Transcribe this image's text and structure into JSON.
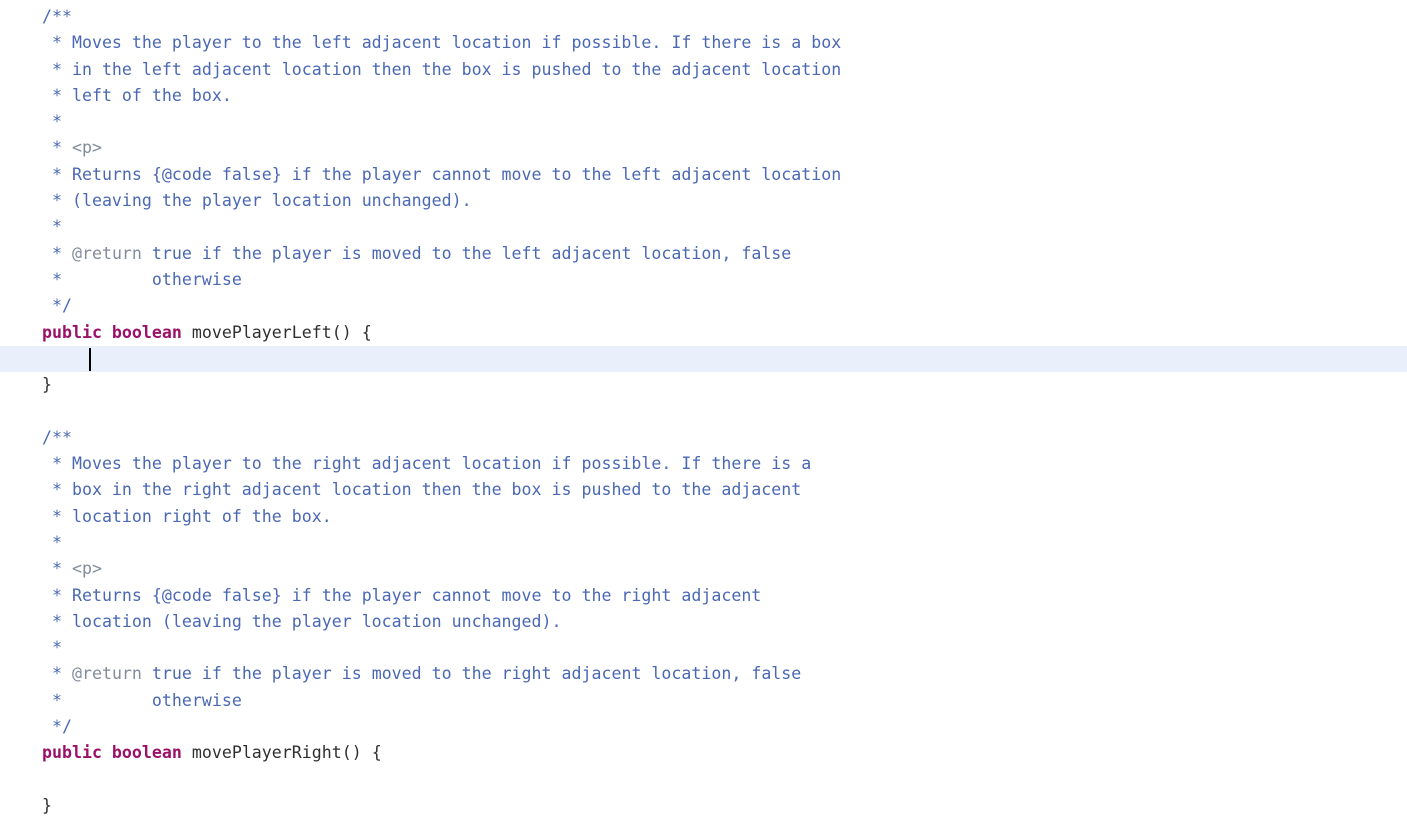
{
  "editor": {
    "language": "java",
    "background_color": "#ffffff",
    "comment_color": "#4a68b3",
    "javadoc_tag_color": "#828c9c",
    "keyword_color": "#9b1069",
    "plain_text_color": "#2f2f2f",
    "current_line_highlight_color": "#e9f0fb",
    "caret_color": "#000000",
    "caret_line_index": 13,
    "caret_column": 4
  },
  "lines": [
    {
      "index": 0,
      "current": false,
      "tokens": [
        {
          "type": "cmt",
          "text": "/**"
        }
      ]
    },
    {
      "index": 1,
      "current": false,
      "tokens": [
        {
          "type": "cmt",
          "text": " * Moves the player to the left adjacent location if possible. If there is a box"
        }
      ]
    },
    {
      "index": 2,
      "current": false,
      "tokens": [
        {
          "type": "cmt",
          "text": " * in the left adjacent location then the box is pushed to the adjacent location"
        }
      ]
    },
    {
      "index": 3,
      "current": false,
      "tokens": [
        {
          "type": "cmt",
          "text": " * left of the box."
        }
      ]
    },
    {
      "index": 4,
      "current": false,
      "tokens": [
        {
          "type": "cmt",
          "text": " *"
        }
      ]
    },
    {
      "index": 5,
      "current": false,
      "tokens": [
        {
          "type": "cmt",
          "text": " * "
        },
        {
          "type": "cmt-tag",
          "text": "<p>"
        }
      ]
    },
    {
      "index": 6,
      "current": false,
      "tokens": [
        {
          "type": "cmt",
          "text": " * Returns {@code false} if the player cannot move to the left adjacent location"
        }
      ]
    },
    {
      "index": 7,
      "current": false,
      "tokens": [
        {
          "type": "cmt",
          "text": " * (leaving the player location unchanged)."
        }
      ]
    },
    {
      "index": 8,
      "current": false,
      "tokens": [
        {
          "type": "cmt",
          "text": " *"
        }
      ]
    },
    {
      "index": 9,
      "current": false,
      "tokens": [
        {
          "type": "cmt",
          "text": " * "
        },
        {
          "type": "cmt-tag",
          "text": "@return"
        },
        {
          "type": "cmt",
          "text": " true if the player is moved to the left adjacent location, false"
        }
      ]
    },
    {
      "index": 10,
      "current": false,
      "tokens": [
        {
          "type": "cmt",
          "text": " *         otherwise"
        }
      ]
    },
    {
      "index": 11,
      "current": false,
      "tokens": [
        {
          "type": "cmt",
          "text": " */"
        }
      ]
    },
    {
      "index": 12,
      "current": false,
      "tokens": [
        {
          "type": "kw",
          "text": "public boolean"
        },
        {
          "type": "plain",
          "text": " movePlayerLeft() {"
        }
      ]
    },
    {
      "index": 13,
      "current": true,
      "tokens": [
        {
          "type": "plain",
          "text": "    "
        }
      ]
    },
    {
      "index": 14,
      "current": false,
      "tokens": [
        {
          "type": "plain",
          "text": "}"
        }
      ]
    },
    {
      "index": 15,
      "current": false,
      "tokens": [
        {
          "type": "plain",
          "text": ""
        }
      ]
    },
    {
      "index": 16,
      "current": false,
      "tokens": [
        {
          "type": "cmt",
          "text": "/**"
        }
      ]
    },
    {
      "index": 17,
      "current": false,
      "tokens": [
        {
          "type": "cmt",
          "text": " * Moves the player to the right adjacent location if possible. If there is a"
        }
      ]
    },
    {
      "index": 18,
      "current": false,
      "tokens": [
        {
          "type": "cmt",
          "text": " * box in the right adjacent location then the box is pushed to the adjacent"
        }
      ]
    },
    {
      "index": 19,
      "current": false,
      "tokens": [
        {
          "type": "cmt",
          "text": " * location right of the box."
        }
      ]
    },
    {
      "index": 20,
      "current": false,
      "tokens": [
        {
          "type": "cmt",
          "text": " *"
        }
      ]
    },
    {
      "index": 21,
      "current": false,
      "tokens": [
        {
          "type": "cmt",
          "text": " * "
        },
        {
          "type": "cmt-tag",
          "text": "<p>"
        }
      ]
    },
    {
      "index": 22,
      "current": false,
      "tokens": [
        {
          "type": "cmt",
          "text": " * Returns {@code false} if the player cannot move to the right adjacent"
        }
      ]
    },
    {
      "index": 23,
      "current": false,
      "tokens": [
        {
          "type": "cmt",
          "text": " * location (leaving the player location unchanged)."
        }
      ]
    },
    {
      "index": 24,
      "current": false,
      "tokens": [
        {
          "type": "cmt",
          "text": " *"
        }
      ]
    },
    {
      "index": 25,
      "current": false,
      "tokens": [
        {
          "type": "cmt",
          "text": " * "
        },
        {
          "type": "cmt-tag",
          "text": "@return"
        },
        {
          "type": "cmt",
          "text": " true if the player is moved to the right adjacent location, false"
        }
      ]
    },
    {
      "index": 26,
      "current": false,
      "tokens": [
        {
          "type": "cmt",
          "text": " *         otherwise"
        }
      ]
    },
    {
      "index": 27,
      "current": false,
      "tokens": [
        {
          "type": "cmt",
          "text": " */"
        }
      ]
    },
    {
      "index": 28,
      "current": false,
      "tokens": [
        {
          "type": "kw",
          "text": "public boolean"
        },
        {
          "type": "plain",
          "text": " movePlayerRight() {"
        }
      ]
    },
    {
      "index": 29,
      "current": false,
      "tokens": [
        {
          "type": "plain",
          "text": ""
        }
      ]
    },
    {
      "index": 30,
      "current": false,
      "tokens": [
        {
          "type": "plain",
          "text": "}"
        }
      ]
    }
  ]
}
